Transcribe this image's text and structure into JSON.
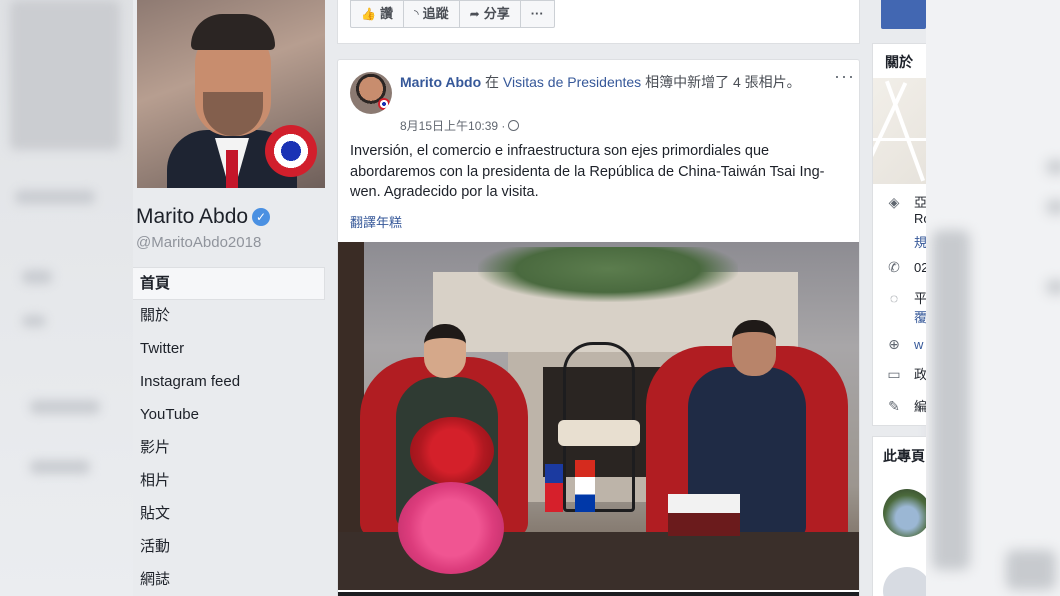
{
  "left": {
    "page_name": "Marito Abdo",
    "verified_glyph": "✓",
    "handle": "@MaritoAbdo2018",
    "nav": [
      {
        "label": "首頁",
        "active": true
      },
      {
        "label": "關於"
      },
      {
        "label": "Twitter"
      },
      {
        "label": "Instagram feed"
      },
      {
        "label": "YouTube"
      },
      {
        "label": "影片"
      },
      {
        "label": "相片"
      },
      {
        "label": "貼文"
      },
      {
        "label": "活動"
      },
      {
        "label": "網誌"
      }
    ]
  },
  "actions": [
    {
      "icon": "like-icon",
      "glyph": "👍",
      "label": "讚"
    },
    {
      "icon": "follow-icon",
      "glyph": "◝",
      "label": "追蹤"
    },
    {
      "icon": "share-icon",
      "glyph": "➦",
      "label": "分享"
    },
    {
      "icon": "more-icon",
      "glyph": "···",
      "label": ""
    }
  ],
  "post": {
    "author": "Marito Abdo",
    "in_word": "在",
    "album": "Visitas de Presidentes",
    "action_text": "相簿中新增了 4 張相片。",
    "timestamp": "8月15日上午10:39 ·",
    "more_glyph": "···",
    "text": "Inversión, el comercio e infraestructura son ejes primordiales que abordaremos con la presidenta de la República de China-Taiwán Tsai Ing-wen. Agradecido por la visita.",
    "translate": "翻譯年糕"
  },
  "right": {
    "about_title": "關於",
    "info": [
      {
        "icon": "location-icon",
        "glyph": "◈",
        "text": "亞"
      },
      {
        "icon": "location-sub",
        "glyph": "",
        "text": "Ro"
      },
      {
        "icon": "location-sub2",
        "glyph": "",
        "text": "規"
      },
      {
        "icon": "phone-icon",
        "glyph": "✆",
        "text": "02"
      },
      {
        "icon": "messenger-icon",
        "glyph": "◌",
        "text": "平"
      },
      {
        "icon": "messenger-sub",
        "glyph": "",
        "text": "覆"
      },
      {
        "icon": "globe-icon",
        "glyph": "⊕",
        "text": "w"
      },
      {
        "icon": "category-icon",
        "glyph": "▭",
        "text": "政"
      },
      {
        "icon": "edit-icon",
        "glyph": "✎",
        "text": "編"
      }
    ],
    "pages_title": "此專頁"
  }
}
